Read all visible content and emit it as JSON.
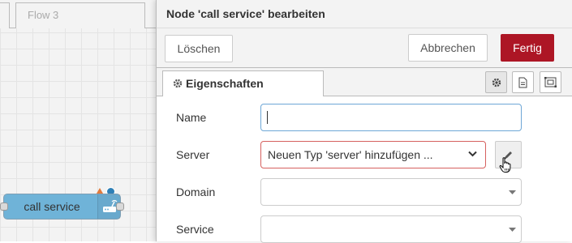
{
  "workspace": {
    "tabs": [
      {
        "label": ""
      },
      {
        "label": "Flow 3"
      }
    ],
    "node": {
      "label": "call service",
      "color": "#6fb3d8",
      "icons": [
        "router-icon",
        "warning-icon",
        "changed-dot-icon"
      ]
    }
  },
  "tray": {
    "title": "Node 'call service' bearbeiten",
    "buttons": {
      "delete": "Löschen",
      "cancel": "Abbrechen",
      "done": "Fertig"
    },
    "tabs": {
      "properties": "Eigenschaften",
      "icon_buttons": [
        "gear-icon",
        "document-icon",
        "appearance-icon"
      ]
    },
    "fields": {
      "name": {
        "label": "Name",
        "value": ""
      },
      "server": {
        "label": "Server",
        "value": "Neuen Typ 'server' hinzufügen ..."
      },
      "domain": {
        "label": "Domain",
        "value": ""
      },
      "service": {
        "label": "Service",
        "value": ""
      }
    }
  },
  "colors": {
    "accent_primary": "#ad1625",
    "invalid_border": "#d6615f",
    "focus_border": "#6ea7d6"
  }
}
